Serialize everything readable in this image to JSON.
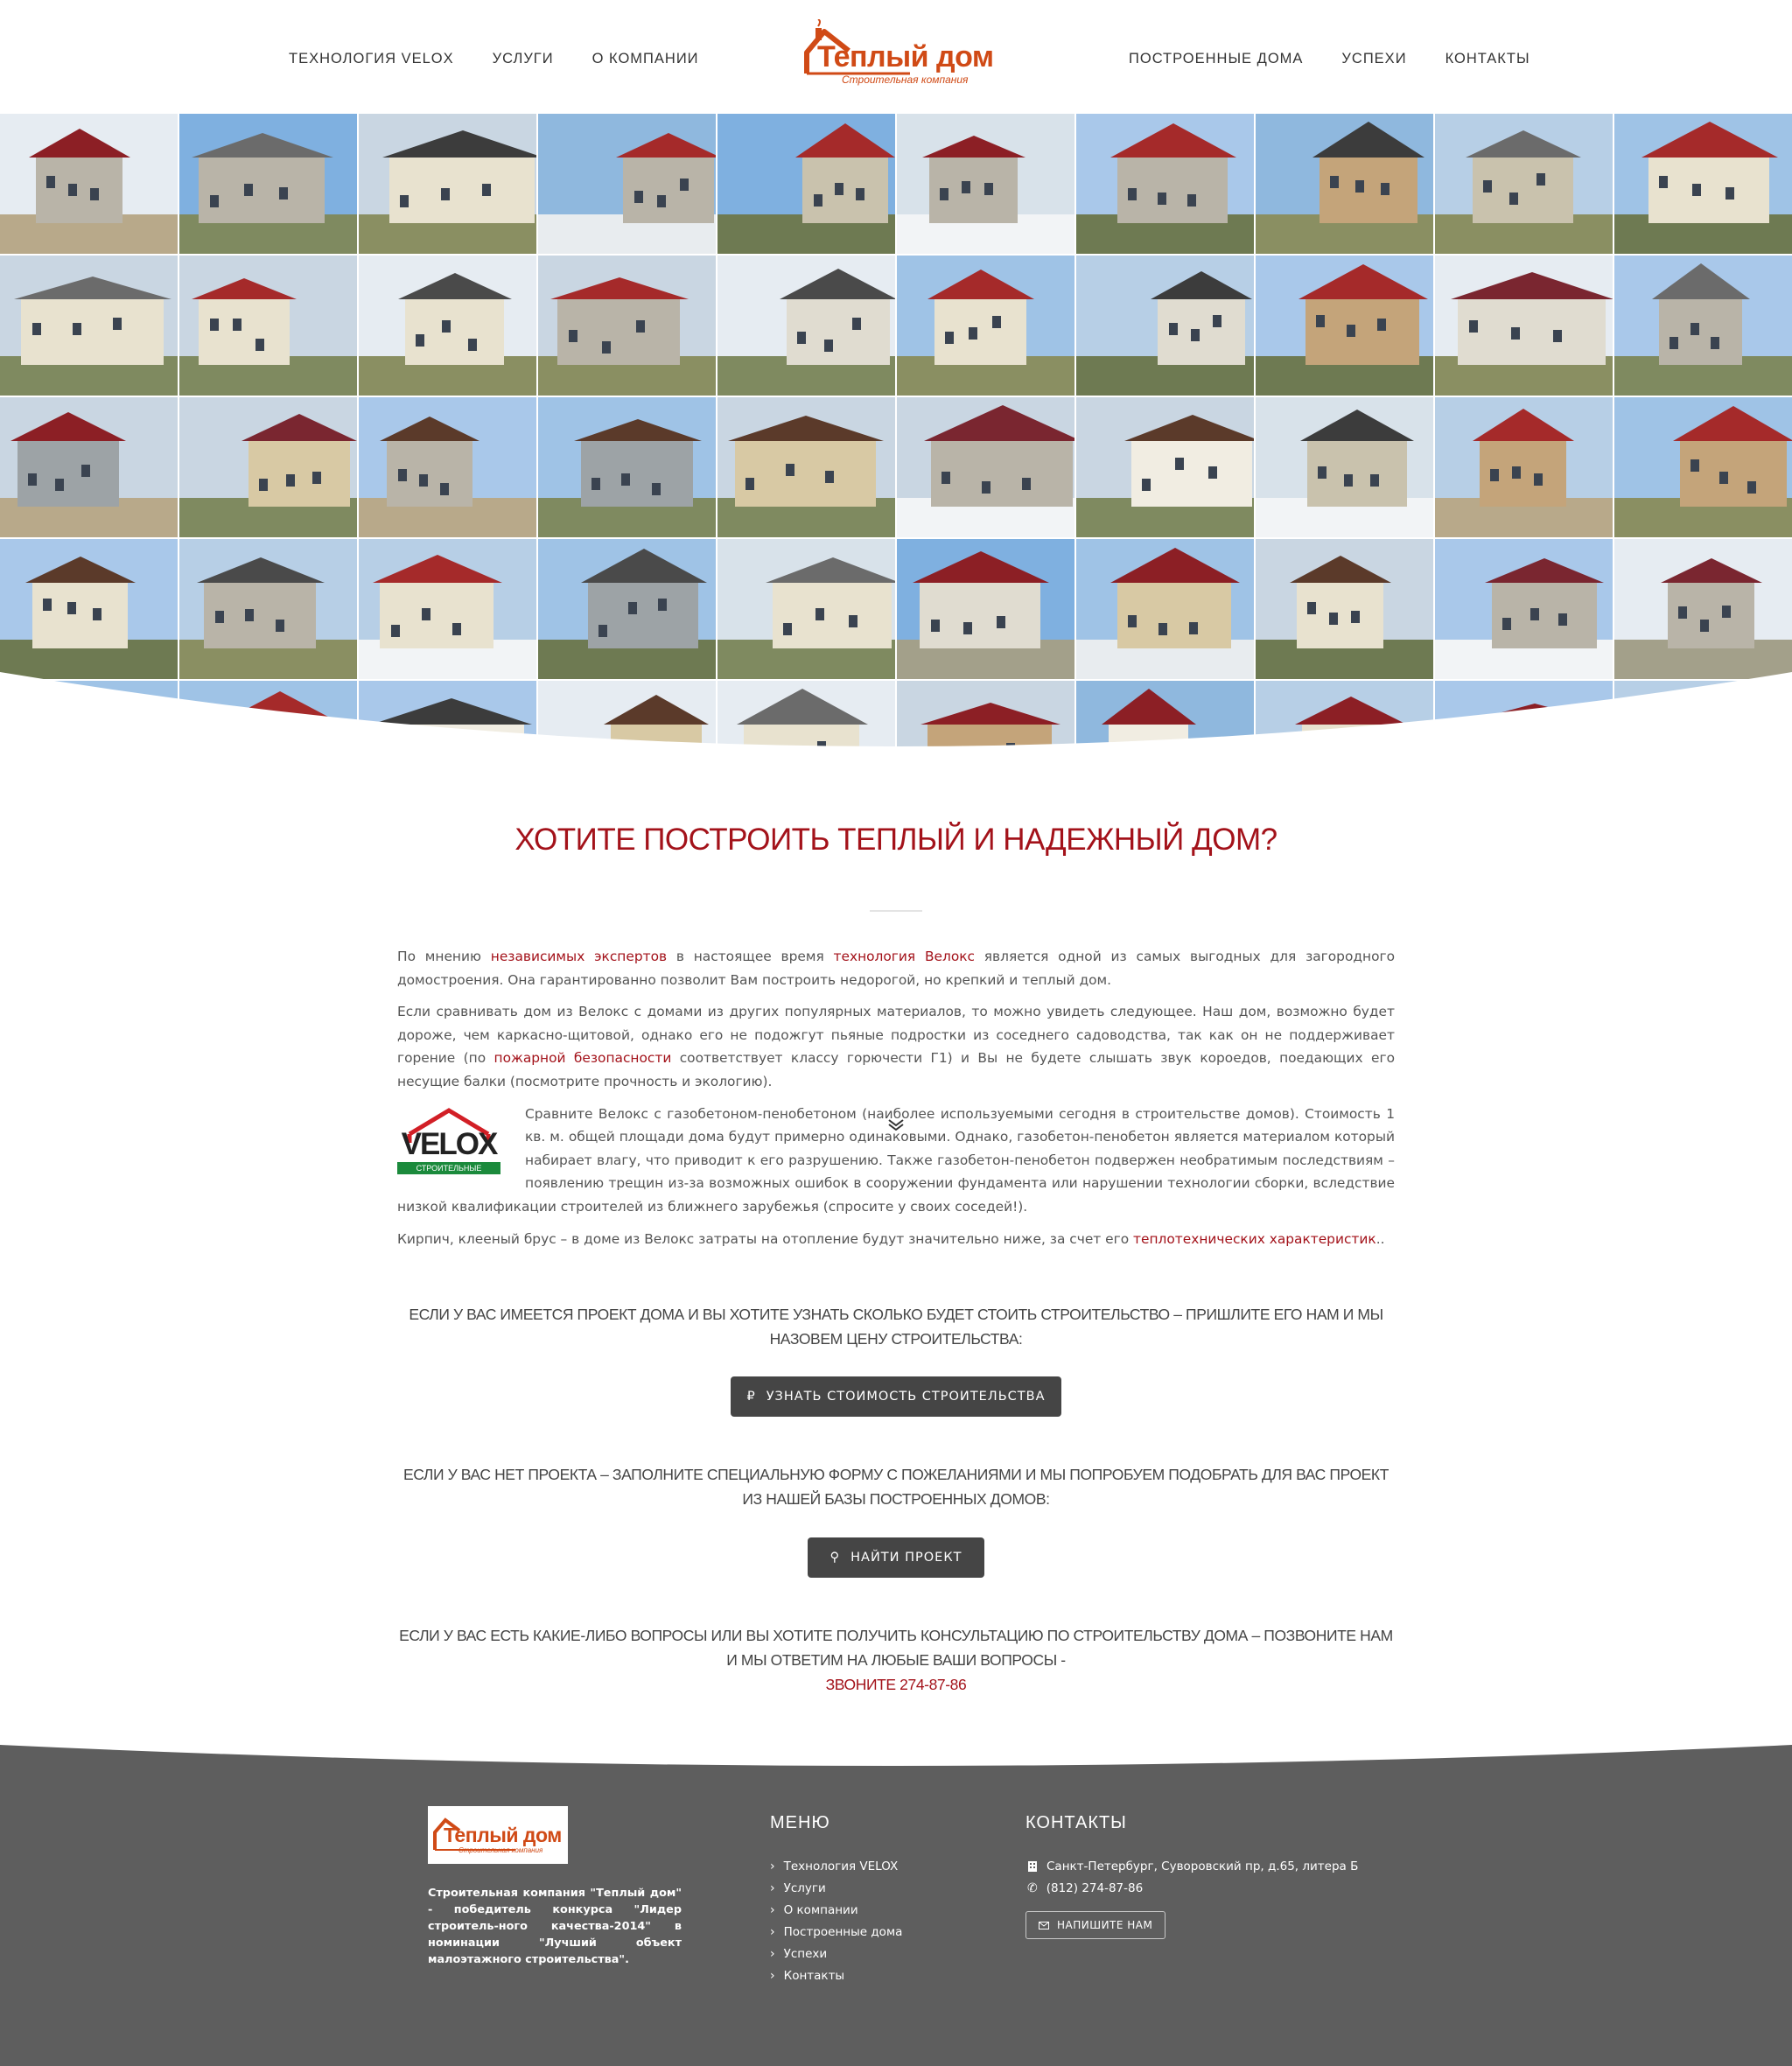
{
  "header": {
    "nav_left": [
      "Технология VELOX",
      "Услуги",
      "О компании"
    ],
    "nav_right": [
      "Построенные дома",
      "Успехи",
      "Контакты"
    ],
    "logo_title": "Теплый дом",
    "logo_subtitle": "Строительная компания"
  },
  "main": {
    "headline": "Хотите построить теплый и надежный дом?",
    "p1": {
      "a": "По мнению ",
      "link1": "независимых экспертов",
      "b": " в настоящее время ",
      "link2": "технология Велокс",
      "c": " является одной из самых выгодных для загородного домостроения. Она гарантированно позволит Вам построить недорогой, но крепкий и теплый дом."
    },
    "p2": {
      "a": "Если сравнивать дом из Велокс с домами из других популярных материалов, то можно увидеть следующее. Наш дом, возможно будет дороже, чем каркасно-щитовой, однако его не подожгут пьяные подростки из соседнего садоводства, так как он не поддерживает горение (по ",
      "link": "пожарной безопасности",
      "b": " соответствует классу горючести Г1) и Вы не будете слышать звук короедов, поедающих его несущие балки (посмотрите прочность и экологию)."
    },
    "velox_logo": {
      "name": "VELOX",
      "tagline": "СТРОИТЕЛЬНЫЕ СИСТЕМЫ"
    },
    "p3": "Сравните Велокс с газобетоном-пенобетоном (наиболее используемыми сегодня в строительстве домов). Стоимость 1 кв. м. общей площади дома будут примерно одинаковыми. Однако, газобетон-пенобетон является материалом который набирает влагу, что приводит к его разрушению. Также газобетон-пенобетон подвержен необратимым последствиям – появлению трещин из-за возможных ошибок в сооружении фундамента или нарушении технологии сборки, вследствие низкой квалификации строителей из ближнего зарубежья (спросите у своих соседей!).",
    "p4": {
      "a": "Кирпич, клееный брус – в доме из Велокс затраты на отопление будут значительно ниже, за счет его ",
      "link": "теплотехнических характеристик",
      "b": ".."
    },
    "cta1": "Если у вас имеется проект дома и вы хотите узнать сколько будет стоить строительство – пришлите его нам и мы назовем цену строительства:",
    "btn1": "Узнать стоимость строительства",
    "btn1_icon": "₽",
    "cta2": "Если у вас нет проекта – заполните специальную форму с пожеланиями и мы попробуем подобрать для вас проект из нашей базы построенных домов:",
    "btn2": "Найти проект",
    "btn2_icon": "⚲",
    "cta3": "Если у вас есть какие-либо вопросы или вы хотите получить консультацию по строительству дома – позвоните нам и мы ответим на любые ваши вопросы -",
    "cta3_call": "Звоните 274-87-86"
  },
  "footer": {
    "logo_title": "Теплый дом",
    "logo_subtitle": "Строительная компания",
    "about": "Строительная компания \"Теплый дом\" - победитель конкурса \"Лидер строитель-ного качества-2014\" в номинации \"Лучший объект малоэтажного строительства\".",
    "menu_heading": "Меню",
    "menu": [
      "Технология VELOX",
      "Услуги",
      "О компании",
      "Построенные дома",
      "Успехи",
      "Контакты"
    ],
    "contacts_heading": "Контакты",
    "address": "Санкт-Петербург, Суворовский пр, д.65, литера Б",
    "phone": "(812) 274-87-86",
    "write_btn": "Напишите нам"
  },
  "colors": {
    "accent": "#a3121a",
    "logo": "#d04a16",
    "button": "#454545",
    "footer": "#5e5e5e"
  }
}
